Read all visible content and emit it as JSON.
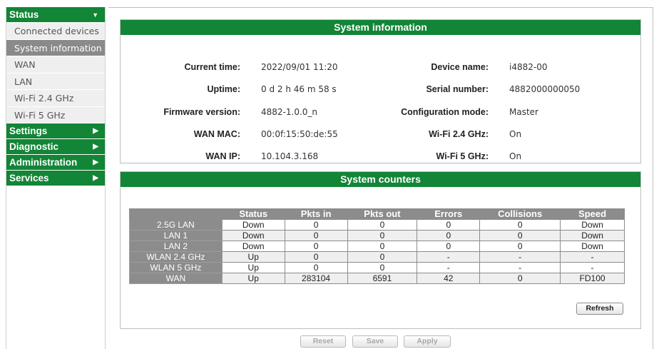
{
  "sidebar": {
    "status": {
      "label": "Status",
      "items": [
        "Connected devices",
        "System information",
        "WAN",
        "LAN",
        "Wi-Fi 2.4 GHz",
        "Wi-Fi 5 GHz"
      ],
      "active": "System information"
    },
    "settings": "Settings",
    "diagnostic": "Diagnostic",
    "administration": "Administration",
    "services": "Services"
  },
  "system_info": {
    "title": "System information",
    "rows": [
      {
        "l_label": "Current time:",
        "l_value": "2022/09/01 11:20",
        "r_label": "Device name:",
        "r_value": "i4882-00"
      },
      {
        "l_label": "Uptime:",
        "l_value": "0 d 2 h 46 m 58 s",
        "r_label": "Serial number:",
        "r_value": "4882000000050"
      },
      {
        "l_label": "Firmware version:",
        "l_value": "4882-1.0.0_n",
        "r_label": "Configuration mode:",
        "r_value": "Master"
      },
      {
        "l_label": "WAN MAC:",
        "l_value": "00:0f:15:50:de:55",
        "r_label": "Wi-Fi 2.4 GHz:",
        "r_value": "On"
      },
      {
        "l_label": "WAN IP:",
        "l_value": "10.104.3.168",
        "r_label": "Wi-Fi 5 GHz:",
        "r_value": "On"
      }
    ]
  },
  "counters": {
    "title": "System counters",
    "headers": [
      "",
      "Status",
      "Pkts in",
      "Pkts out",
      "Errors",
      "Collisions",
      "Speed"
    ],
    "rows": [
      [
        "2.5G LAN",
        "Down",
        "0",
        "0",
        "0",
        "0",
        "Down"
      ],
      [
        "LAN 1",
        "Down",
        "0",
        "0",
        "0",
        "0",
        "Down"
      ],
      [
        "LAN 2",
        "Down",
        "0",
        "0",
        "0",
        "0",
        "Down"
      ],
      [
        "WLAN 2.4 GHz",
        "Up",
        "0",
        "0",
        "-",
        "-",
        "-"
      ],
      [
        "WLAN 5 GHz",
        "Up",
        "0",
        "0",
        "-",
        "-",
        "-"
      ],
      [
        "WAN",
        "Up",
        "283104",
        "6591",
        "42",
        "0",
        "FD100"
      ]
    ],
    "refresh_label": "Refresh"
  },
  "buttons": {
    "reset": "Reset",
    "save": "Save",
    "apply": "Apply"
  },
  "colors": {
    "accent": "#128537",
    "header_gray": "#8c8c8c",
    "active_item": "#8a8a8a"
  }
}
